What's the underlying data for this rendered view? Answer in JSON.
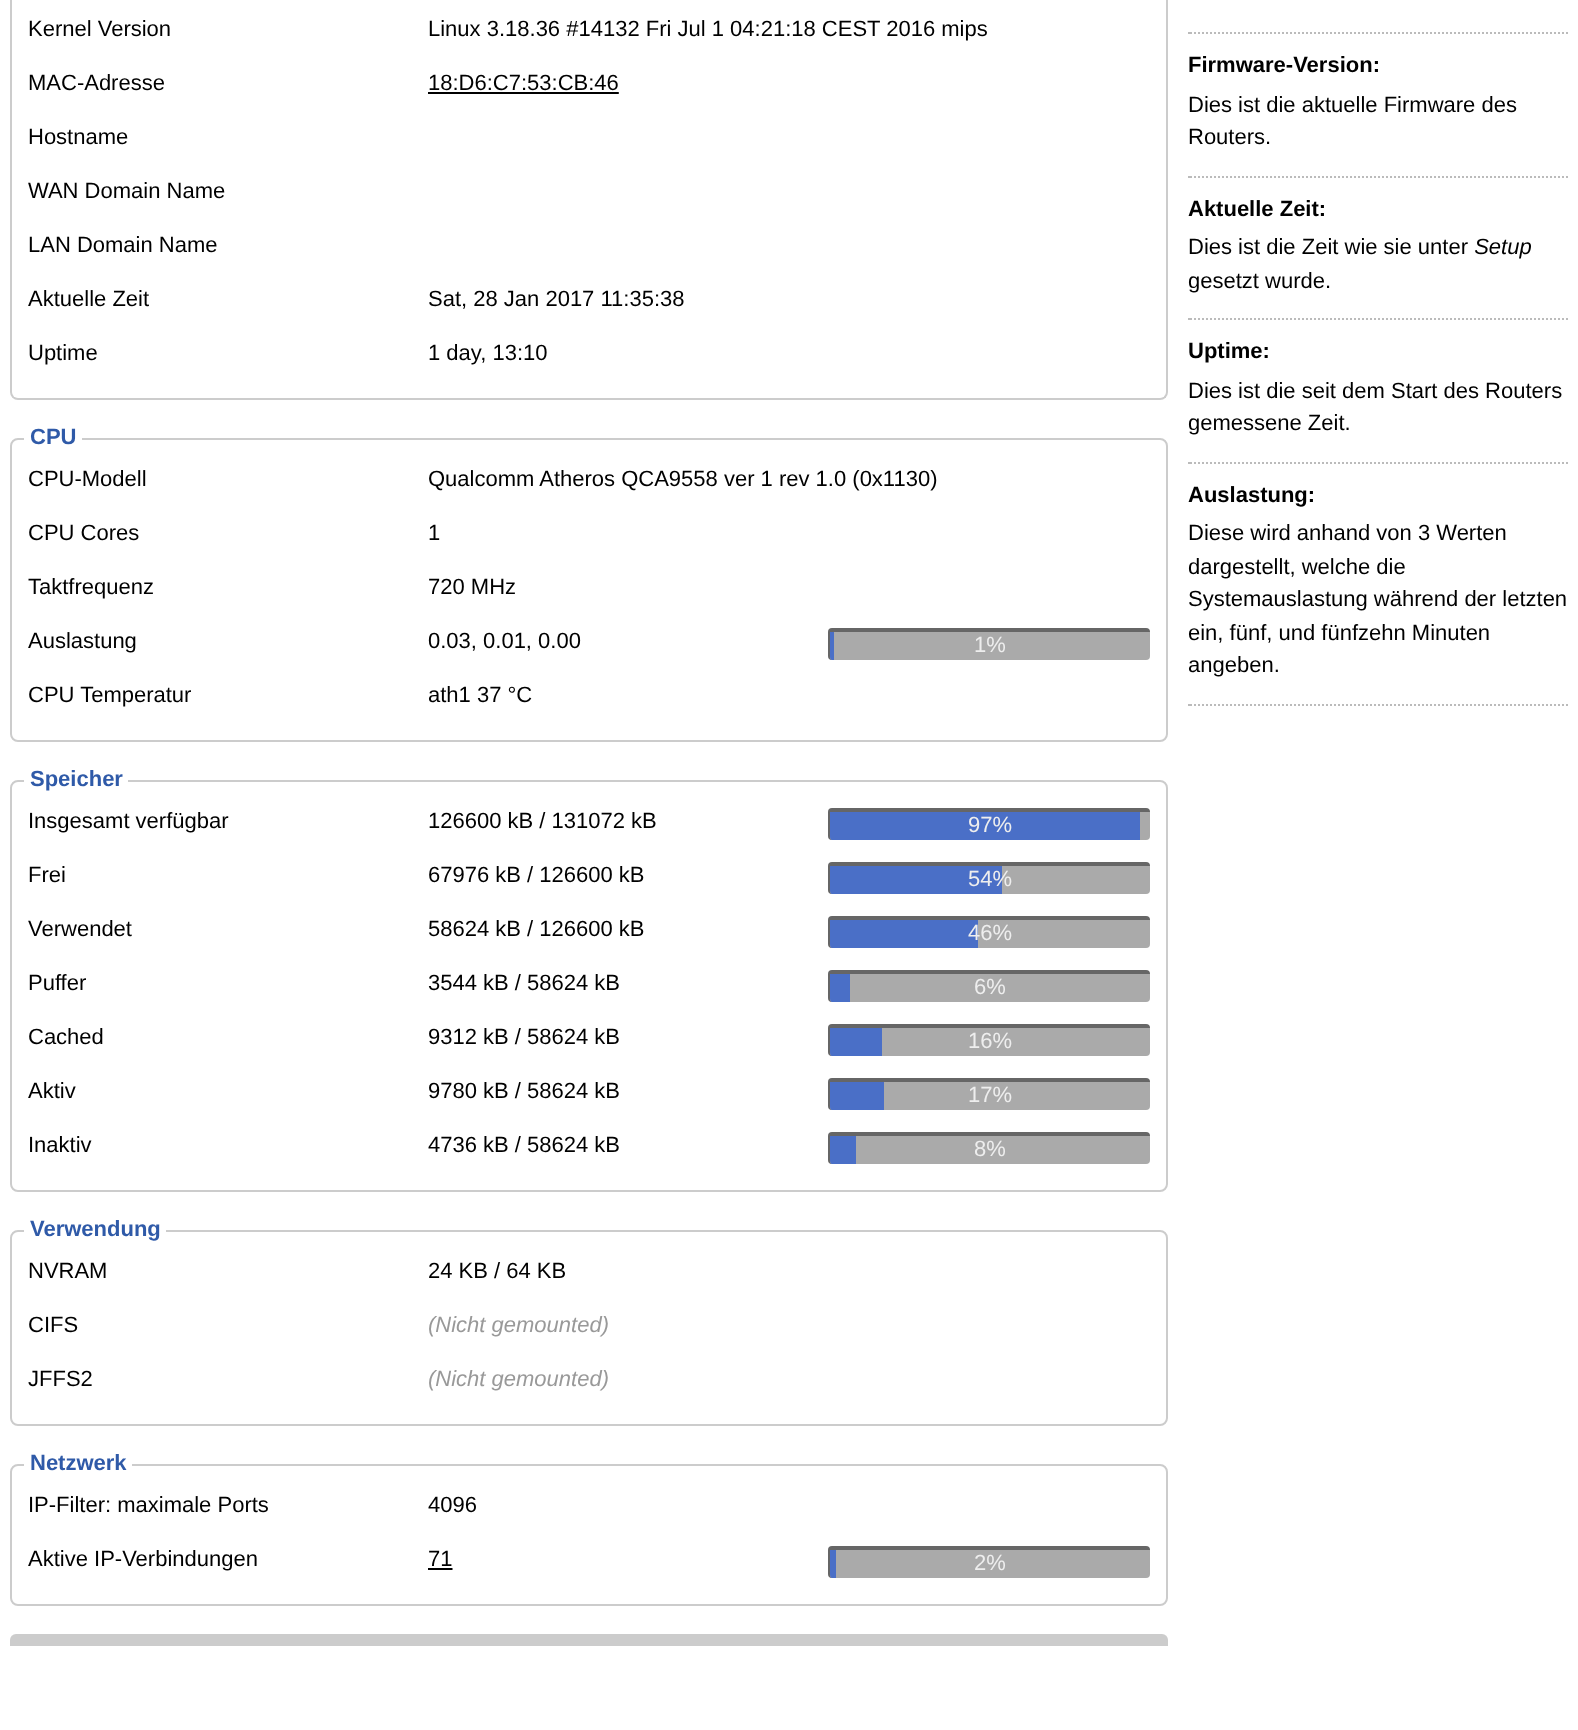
{
  "sections": [
    {
      "rows": [
        {
          "label": "Kernel Version",
          "value": "Linux 3.18.36 #14132 Fri Jul 1 04:21:18 CEST 2016 mips",
          "kind": "plain"
        },
        {
          "label": "MAC-Adresse",
          "value": "18:D6:C7:53:CB:46",
          "kind": "link"
        },
        {
          "label": "Hostname"
        },
        {
          "label": "WAN Domain Name"
        },
        {
          "label": "LAN Domain Name"
        },
        {
          "label": "Aktuelle Zeit",
          "value": "Sat, 28 Jan 2017 11:35:38",
          "kind": "plain"
        },
        {
          "label": "Uptime",
          "value": "1 day, 13:10",
          "kind": "plain"
        }
      ]
    },
    {
      "legend": "CPU",
      "rows": [
        {
          "label": "CPU-Modell",
          "value": "Qualcomm Atheros QCA9558 ver 1 rev 1.0 (0x1130)",
          "kind": "plain"
        },
        {
          "label": "CPU Cores",
          "value": "1",
          "kind": "plain"
        },
        {
          "label": "Taktfrequenz",
          "value": "720 MHz",
          "kind": "plain"
        },
        {
          "label": "Auslastung",
          "value": "0.03, 0.01, 0.00",
          "kind": "plain",
          "level": 0.01,
          "reading": "1%"
        },
        {
          "label": "CPU Temperatur",
          "value": "ath1 37 °C",
          "kind": "plain"
        }
      ]
    },
    {
      "legend": "Speicher",
      "rows": [
        {
          "label": "Insgesamt verfügbar",
          "value": "126600 kB / 131072 kB",
          "kind": "plain",
          "level": 0.97,
          "reading": "97%"
        },
        {
          "label": "Frei",
          "value": "67976 kB / 126600 kB",
          "kind": "plain",
          "level": 0.54,
          "reading": "54%"
        },
        {
          "label": "Verwendet",
          "value": "58624 kB / 126600 kB",
          "kind": "plain",
          "level": 0.46,
          "reading": "46%"
        },
        {
          "label": "Puffer",
          "value": "3544 kB / 58624 kB",
          "kind": "plain",
          "level": 0.06,
          "reading": "6%"
        },
        {
          "label": "Cached",
          "value": "9312 kB / 58624 kB",
          "kind": "plain",
          "level": 0.16,
          "reading": "16%"
        },
        {
          "label": "Aktiv",
          "value": "9780 kB / 58624 kB",
          "kind": "plain",
          "level": 0.17,
          "reading": "17%"
        },
        {
          "label": "Inaktiv",
          "value": "4736 kB / 58624 kB",
          "kind": "plain",
          "level": 0.08,
          "reading": "8%"
        }
      ]
    },
    {
      "legend": "Verwendung",
      "rows": [
        {
          "label": "NVRAM",
          "value": "24 KB / 64 KB",
          "kind": "plain"
        },
        {
          "label": "CIFS",
          "value": "(Nicht gemounted)",
          "kind": "missing"
        },
        {
          "label": "JFFS2",
          "value": "(Nicht gemounted)",
          "kind": "missing"
        }
      ]
    },
    {
      "legend": "Netzwerk",
      "rows": [
        {
          "label": "IP-Filter: maximale Ports",
          "value": "4096",
          "kind": "plain"
        },
        {
          "label": "Aktive IP-Verbindungen",
          "value": "71",
          "kind": "link",
          "level": 0.02,
          "reading": "2%"
        }
      ]
    }
  ],
  "help": [
    {
      "title": "Firmware-Version:",
      "text": "Dies ist die aktuelle Firmware des Routers."
    },
    {
      "title": "Aktuelle Zeit:",
      "text": "Dies ist die Zeit wie sie unter *Setup* gesetzt wurde."
    },
    {
      "title": "Uptime:",
      "text": "Dies ist die seit dem Start des Routers gemessene Zeit."
    },
    {
      "title": "Auslastung:",
      "text": "Diese wird anhand von 3 Werten dargestellt, welche die Systemauslastung während der letzten ein, fünf, und fünfzehn Minuten angeben."
    }
  ]
}
